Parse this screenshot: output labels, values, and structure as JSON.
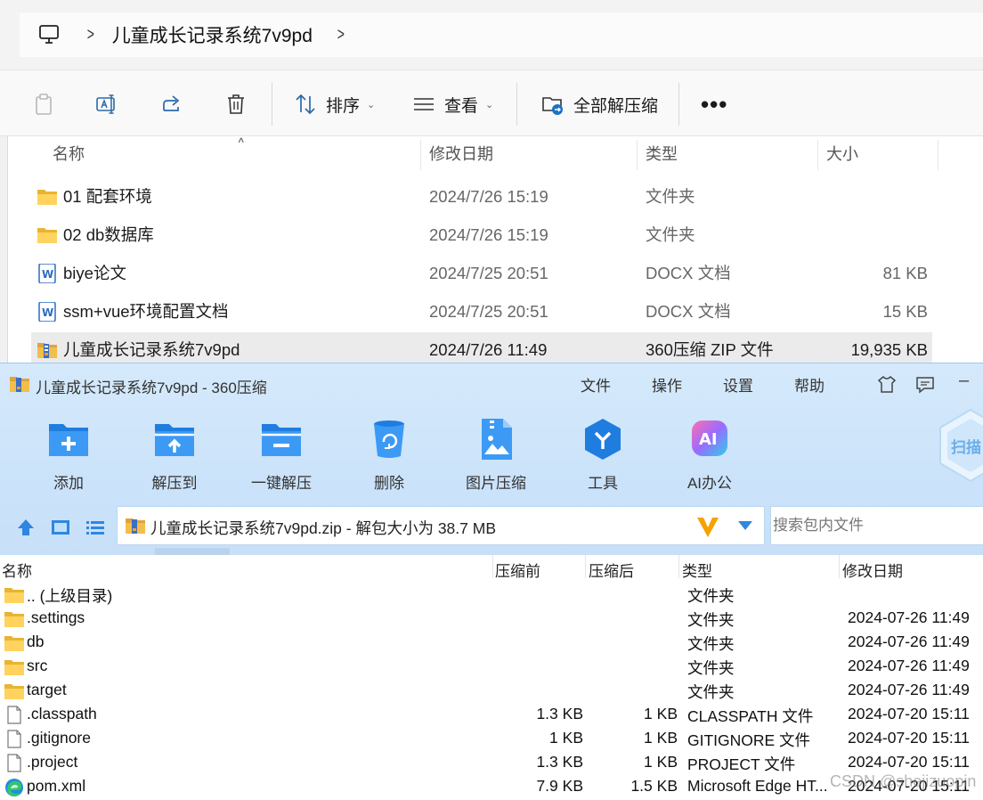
{
  "explorer": {
    "breadcrumb": {
      "folder": "儿童成长记录系统7v9pd"
    },
    "toolbar": {
      "sort_label": "排序",
      "view_label": "查看",
      "extract_all_label": "全部解压缩",
      "more_label": "•••"
    },
    "columns": {
      "name": "名称",
      "date": "修改日期",
      "type": "类型",
      "size": "大小"
    },
    "files": [
      {
        "name": "01 配套环境",
        "date": "2024/7/26 15:19",
        "type": "文件夹",
        "size": "",
        "icon": "folder-icon"
      },
      {
        "name": "02 db数据库",
        "date": "2024/7/26 15:19",
        "type": "文件夹",
        "size": "",
        "icon": "folder-icon"
      },
      {
        "name": "biye论文",
        "date": "2024/7/25 20:51",
        "type": "DOCX 文档",
        "size": "81 KB",
        "icon": "docx-icon"
      },
      {
        "name": "ssm+vue环境配置文档",
        "date": "2024/7/25 20:51",
        "type": "DOCX 文档",
        "size": "15 KB",
        "icon": "docx-icon"
      },
      {
        "name": "儿童成长记录系统7v9pd",
        "date": "2024/7/26 11:49",
        "type": "360压缩 ZIP 文件",
        "size": "19,935 KB",
        "icon": "zip-icon"
      }
    ]
  },
  "zipapp": {
    "title": "儿童成长记录系统7v9pd - 360压缩",
    "menu": {
      "file": "文件",
      "ops": "操作",
      "settings": "设置",
      "help": "帮助"
    },
    "tools": {
      "add": "添加",
      "extract_to": "解压到",
      "one_click": "一键解压",
      "delete": "删除",
      "image_compress": "图片压缩",
      "tools": "工具",
      "ai_office": "AI办公",
      "ai_badge": "AI",
      "scan": "扫描"
    },
    "path_text": "儿童成长记录系统7v9pd.zip - 解包大小为 38.7 MB",
    "search_placeholder": "搜索包内文件",
    "columns": {
      "name": "名称",
      "before": "压缩前",
      "after": "压缩后",
      "type": "类型",
      "modified": "修改日期"
    },
    "entries": [
      {
        "name": ".. (上级目录)",
        "before": "",
        "after": "",
        "type": "文件夹",
        "modified": "",
        "icon": "folder-icon"
      },
      {
        "name": ".settings",
        "before": "",
        "after": "",
        "type": "文件夹",
        "modified": "2024-07-26 11:49",
        "icon": "folder-icon"
      },
      {
        "name": "db",
        "before": "",
        "after": "",
        "type": "文件夹",
        "modified": "2024-07-26 11:49",
        "icon": "folder-icon"
      },
      {
        "name": "src",
        "before": "",
        "after": "",
        "type": "文件夹",
        "modified": "2024-07-26 11:49",
        "icon": "folder-icon"
      },
      {
        "name": "target",
        "before": "",
        "after": "",
        "type": "文件夹",
        "modified": "2024-07-26 11:49",
        "icon": "folder-icon"
      },
      {
        "name": ".classpath",
        "before": "1.3 KB",
        "after": "1 KB",
        "type": "CLASSPATH 文件",
        "modified": "2024-07-20 15:11",
        "icon": "file-icon"
      },
      {
        "name": ".gitignore",
        "before": "1 KB",
        "after": "1 KB",
        "type": "GITIGNORE 文件",
        "modified": "2024-07-20 15:11",
        "icon": "file-icon"
      },
      {
        "name": ".project",
        "before": "1.3 KB",
        "after": "1 KB",
        "type": "PROJECT 文件",
        "modified": "2024-07-20 15:11",
        "icon": "file-icon"
      },
      {
        "name": "pom.xml",
        "before": "7.9 KB",
        "after": "1.5 KB",
        "type": "Microsoft Edge HT...",
        "modified": "2024-07-20 15:11",
        "icon": "edge-icon"
      }
    ],
    "watermark": "CSDN @shejizuopin"
  }
}
